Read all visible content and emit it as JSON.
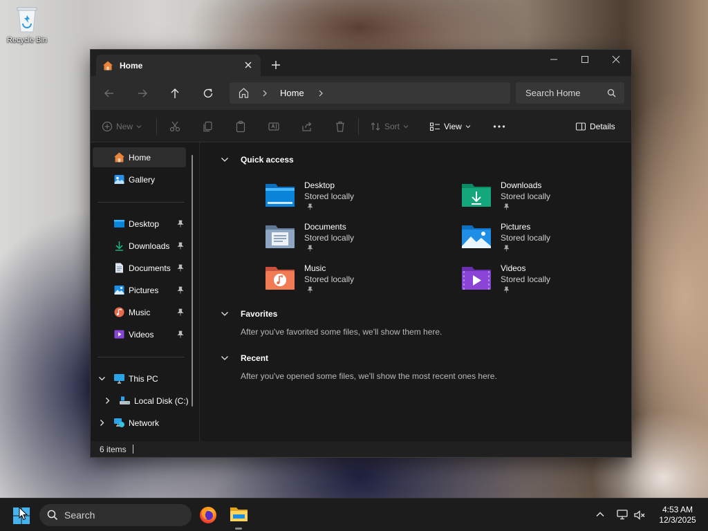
{
  "desktop": {
    "recycle_bin_label": "Recycle Bin"
  },
  "window": {
    "tab_title": "Home",
    "tab_icon": "home-icon",
    "nav": {
      "back_icon": "arrow-left-icon",
      "forward_icon": "arrow-right-icon",
      "up_icon": "arrow-up-icon",
      "refresh_icon": "refresh-icon"
    },
    "address": {
      "breadcrumb": "Home"
    },
    "search": {
      "placeholder": "Search Home"
    },
    "toolbar": {
      "new_label": "New",
      "sort_label": "Sort",
      "view_label": "View",
      "details_label": "Details",
      "disabled_icons": [
        "cut-icon",
        "copy-icon",
        "paste-icon",
        "rename-icon",
        "share-icon",
        "delete-icon"
      ]
    },
    "sidebar": {
      "top": [
        {
          "label": "Home",
          "icon": "home-icon",
          "selected": true
        },
        {
          "label": "Gallery",
          "icon": "gallery-icon"
        }
      ],
      "pinned": [
        {
          "label": "Desktop",
          "icon": "desktop-folder-icon"
        },
        {
          "label": "Downloads",
          "icon": "downloads-icon"
        },
        {
          "label": "Documents",
          "icon": "documents-icon"
        },
        {
          "label": "Pictures",
          "icon": "pictures-icon"
        },
        {
          "label": "Music",
          "icon": "music-icon"
        },
        {
          "label": "Videos",
          "icon": "videos-icon"
        }
      ],
      "tree": [
        {
          "label": "This PC",
          "icon": "monitor-icon",
          "expanded": true
        },
        {
          "label": "Local Disk (C:)",
          "icon": "drive-icon",
          "expanded": false
        },
        {
          "label": "Network",
          "icon": "network-icon",
          "expanded": false
        }
      ]
    },
    "quick_access": {
      "title": "Quick access",
      "items": [
        {
          "name": "Desktop",
          "status": "Stored locally",
          "color": "#0a84d8"
        },
        {
          "name": "Downloads",
          "status": "Stored locally",
          "color": "#14a77b"
        },
        {
          "name": "Documents",
          "status": "Stored locally",
          "color": "#7e97b4"
        },
        {
          "name": "Pictures",
          "status": "Stored locally",
          "color": "#1f8ee6"
        },
        {
          "name": "Music",
          "status": "Stored locally",
          "color": "#e8684b"
        },
        {
          "name": "Videos",
          "status": "Stored locally",
          "color": "#8b45d6"
        }
      ]
    },
    "favorites": {
      "title": "Favorites",
      "empty": "After you've favorited some files, we'll show them here."
    },
    "recent": {
      "title": "Recent",
      "empty": "After you've opened some files, we'll show the most recent ones here."
    },
    "status": {
      "count": "6 items"
    }
  },
  "taskbar": {
    "search_label": "Search",
    "pinned": [
      "firefox-icon",
      "file-explorer-icon"
    ],
    "clock": {
      "time": "4:53 AM",
      "date": "12/3/2025"
    }
  },
  "colors": {
    "window_bg": "#191919",
    "chrome_bg": "#202020",
    "accent": "#0a84d8"
  }
}
